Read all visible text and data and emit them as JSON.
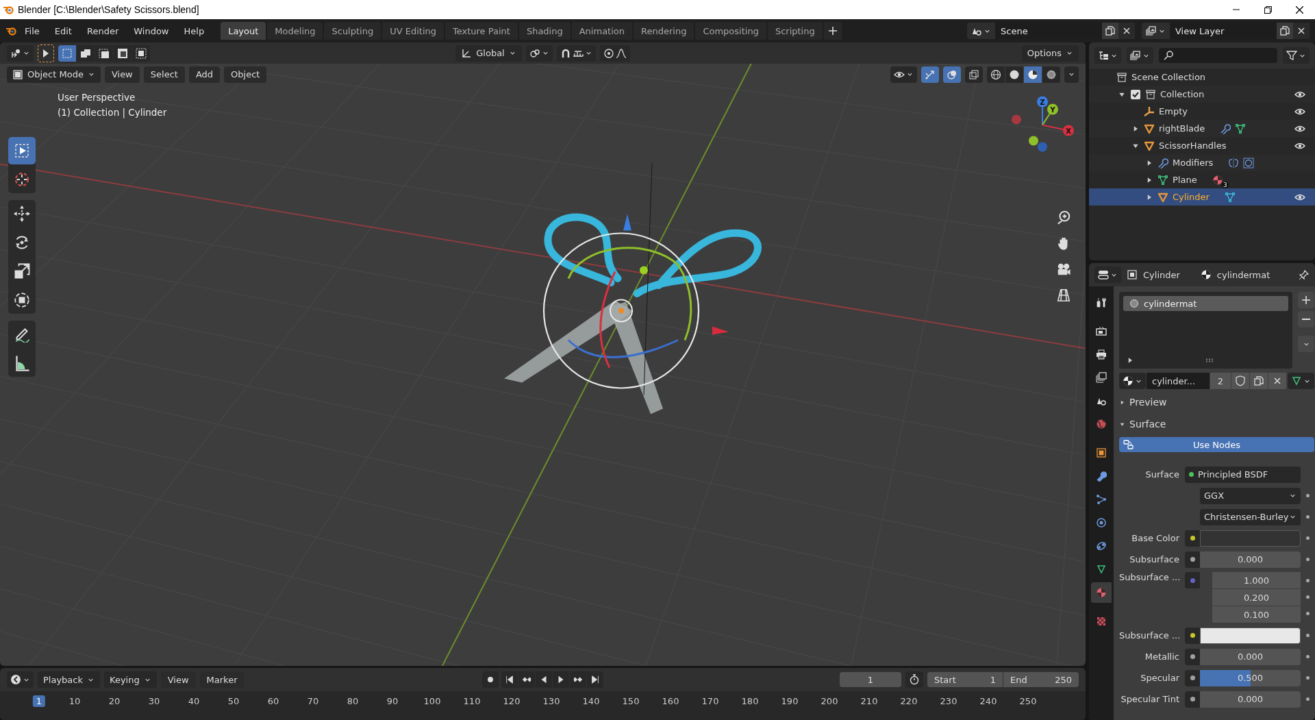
{
  "window": {
    "title": "Blender [C:\\Blender\\Safety Scissors.blend]"
  },
  "menu": [
    "File",
    "Edit",
    "Render",
    "Window",
    "Help"
  ],
  "workspaces": [
    {
      "label": "Layout",
      "selected": true
    },
    {
      "label": "Modeling",
      "selected": false
    },
    {
      "label": "Sculpting",
      "selected": false
    },
    {
      "label": "UV Editing",
      "selected": false
    },
    {
      "label": "Texture Paint",
      "selected": false
    },
    {
      "label": "Shading",
      "selected": false
    },
    {
      "label": "Animation",
      "selected": false
    },
    {
      "label": "Rendering",
      "selected": false
    },
    {
      "label": "Compositing",
      "selected": false
    },
    {
      "label": "Scripting",
      "selected": false
    }
  ],
  "scene": {
    "name": "Scene"
  },
  "view_layer": {
    "name": "View Layer"
  },
  "viewport": {
    "orientation": "Global",
    "options": "Options",
    "select_modes": [
      {
        "selected": true
      },
      {
        "selected": false
      },
      {
        "selected": false
      },
      {
        "selected": false
      },
      {
        "selected": false
      }
    ],
    "mode": "Object Mode",
    "menus": [
      "View",
      "Select",
      "Add",
      "Object"
    ],
    "toggles": [
      {
        "kind": "gizmo",
        "on": true
      },
      {
        "kind": "overlay",
        "on": true
      },
      {
        "kind": "xray",
        "on": false
      }
    ],
    "shading": [
      {
        "kind": "wireframe",
        "selected": false
      },
      {
        "kind": "solid",
        "selected": false
      },
      {
        "kind": "material",
        "selected": true
      },
      {
        "kind": "rendered",
        "selected": false
      }
    ],
    "info": [
      "User Perspective",
      "(1) Collection | Cylinder"
    ],
    "tools": [
      {
        "kind": "select",
        "selected": true
      },
      {
        "kind": "cursor",
        "selected": false
      },
      {
        "kind": "move",
        "selected": false
      },
      {
        "kind": "rotate",
        "selected": false
      },
      {
        "kind": "scale",
        "selected": false
      },
      {
        "kind": "transform",
        "selected": false
      },
      {
        "kind": "annotate",
        "selected": false
      },
      {
        "kind": "measure",
        "selected": false
      }
    ],
    "gizmo_axes": [
      "X",
      "Y",
      "Z"
    ]
  },
  "outliner": {
    "tree": [
      {
        "label": "Scene Collection",
        "kind": "scene_collection",
        "selected": false,
        "children": [
          {
            "label": "Collection",
            "kind": "collection",
            "expanded": true,
            "checked": true,
            "visible": true,
            "selected": false,
            "children": [
              {
                "label": "Empty",
                "kind": "empty",
                "visible": true,
                "selected": false
              },
              {
                "label": "rightBlade",
                "kind": "mesh",
                "expanded": false,
                "visible": true,
                "selected": false,
                "extras": [
                  {
                    "kind": "wrench"
                  },
                  {
                    "kind": "meshdata"
                  }
                ]
              },
              {
                "label": "ScissorHandles",
                "kind": "mesh",
                "expanded": true,
                "visible": true,
                "selected": false,
                "children": [
                  {
                    "label": "Modifiers",
                    "kind": "wrench",
                    "expanded": false,
                    "selected": false,
                    "extras": [
                      {
                        "kind": "mirror"
                      },
                      {
                        "kind": "subsurf"
                      }
                    ]
                  },
                  {
                    "label": "Plane",
                    "kind": "meshdata",
                    "expanded": false,
                    "selected": false,
                    "extras": [
                      {
                        "kind": "material",
                        "badge": "3"
                      }
                    ]
                  },
                  {
                    "label": "Cylinder",
                    "kind": "mesh",
                    "expanded": false,
                    "visible": true,
                    "selected": true,
                    "extras": [
                      {
                        "kind": "meshdata_cyan"
                      }
                    ]
                  }
                ]
              }
            ]
          }
        ]
      }
    ]
  },
  "properties": {
    "object": "Cylinder",
    "material": "cylindermat",
    "tabs": [
      {
        "kind": "tool",
        "selected": false
      },
      {
        "kind": "render",
        "selected": false
      },
      {
        "kind": "output",
        "selected": false
      },
      {
        "kind": "viewlayer",
        "selected": false
      },
      {
        "kind": "scene",
        "selected": false
      },
      {
        "kind": "world",
        "selected": false
      },
      {
        "kind": "object",
        "selected": false
      },
      {
        "kind": "modifier",
        "selected": false
      },
      {
        "kind": "particles",
        "selected": false
      },
      {
        "kind": "physics",
        "selected": false
      },
      {
        "kind": "constraints",
        "selected": false
      },
      {
        "kind": "data",
        "selected": false
      },
      {
        "kind": "material",
        "selected": true
      },
      {
        "kind": "texture",
        "selected": false
      }
    ],
    "slots": [
      {
        "label": "cylindermat",
        "selected": true
      }
    ],
    "datablock": {
      "name": "cylinder...",
      "users": "2"
    },
    "panels": [
      {
        "label": "Preview",
        "expanded": false
      },
      {
        "label": "Surface",
        "expanded": true
      }
    ],
    "use_nodes": {
      "label": "Use Nodes",
      "on": true
    },
    "fields": [
      {
        "kind": "shader",
        "label": "Surface",
        "value": "Principled BSDF",
        "color": "#4fc35a"
      },
      {
        "kind": "dropdown",
        "value": "GGX"
      },
      {
        "kind": "dropdown",
        "value": "Christensen-Burley"
      },
      {
        "kind": "color",
        "label": "Base Color",
        "color": "#c7c729",
        "swatch": {
          "color": "#333333"
        }
      },
      {
        "kind": "number",
        "label": "Subsurface",
        "value": "0.000",
        "color": "#a1a1a1"
      },
      {
        "kind": "vector",
        "label": "Subsurface ...",
        "values": [
          "1.000",
          "0.200",
          "0.100"
        ],
        "color": "#6363c7"
      },
      {
        "kind": "color",
        "label": "Subsurface ...",
        "color": "#c7c729",
        "swatch": {
          "color": "#e8e8e8"
        }
      },
      {
        "kind": "number",
        "label": "Metallic",
        "value": "0.000",
        "color": "#a1a1a1"
      },
      {
        "kind": "number",
        "label": "Specular",
        "value": "0.500",
        "color": "#a1a1a1",
        "level": 0.5
      },
      {
        "kind": "number",
        "label": "Specular Tint",
        "value": "0.000",
        "color": "#a1a1a1"
      }
    ]
  },
  "timeline": {
    "menus": [
      {
        "label": "Playback",
        "kind": "dropdown"
      },
      {
        "label": "Keying",
        "kind": "dropdown"
      },
      {
        "label": "View",
        "kind": "menu"
      },
      {
        "label": "Marker",
        "kind": "menu"
      }
    ],
    "frame": "1",
    "start_label": "Start",
    "start": "1",
    "end_label": "End",
    "end": "250",
    "ruler": [
      {
        "label": "1",
        "selected": true
      },
      {
        "label": "10",
        "selected": false
      },
      {
        "label": "20",
        "selected": false
      },
      {
        "label": "30",
        "selected": false
      },
      {
        "label": "40",
        "selected": false
      },
      {
        "label": "50",
        "selected": false
      },
      {
        "label": "60",
        "selected": false
      },
      {
        "label": "70",
        "selected": false
      },
      {
        "label": "80",
        "selected": false
      },
      {
        "label": "90",
        "selected": false
      },
      {
        "label": "100",
        "selected": false
      },
      {
        "label": "110",
        "selected": false
      },
      {
        "label": "120",
        "selected": false
      },
      {
        "label": "130",
        "selected": false
      },
      {
        "label": "140",
        "selected": false
      },
      {
        "label": "150",
        "selected": false
      },
      {
        "label": "160",
        "selected": false
      },
      {
        "label": "170",
        "selected": false
      },
      {
        "label": "180",
        "selected": false
      },
      {
        "label": "190",
        "selected": false
      },
      {
        "label": "200",
        "selected": false
      },
      {
        "label": "210",
        "selected": false
      },
      {
        "label": "220",
        "selected": false
      },
      {
        "label": "230",
        "selected": false
      },
      {
        "label": "240",
        "selected": false
      },
      {
        "label": "250",
        "selected": false
      }
    ]
  }
}
